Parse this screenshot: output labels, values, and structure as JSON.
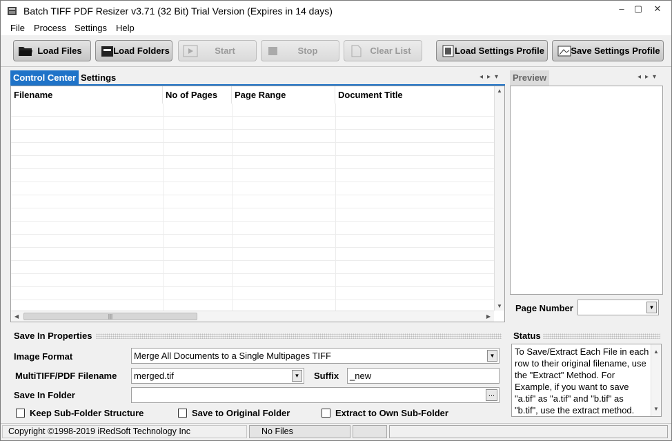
{
  "window": {
    "title": "Batch TIFF PDF Resizer v3.71 (32 Bit)  Trial Version (Expires in 14 days)",
    "controls": [
      "–",
      "▢",
      "✕"
    ]
  },
  "menu": [
    "File",
    "Process",
    "Settings",
    "Help"
  ],
  "toolbar": {
    "load_files": "Load Files",
    "load_folders": "Load Folders",
    "start": "Start",
    "stop": "Stop",
    "clear_list": "Clear List",
    "load_settings_profile": "Load Settings Profile",
    "save_settings_profile": "Save Settings Profile"
  },
  "tabs": {
    "control_center": "Control Center",
    "settings": "Settings",
    "preview": "Preview"
  },
  "grid": {
    "columns": [
      "Filename",
      "No of Pages",
      "Page Range",
      "Document Title"
    ],
    "rows": []
  },
  "preview": {
    "page_number_label": "Page Number",
    "page_number_value": ""
  },
  "save_in_properties": {
    "title": "Save In Properties",
    "image_format_label": "Image Format",
    "image_format_value": "Merge All Documents to a Single Multipages TIFF",
    "multitiff_label": "MultiTIFF/PDF Filename",
    "multitiff_value": "merged.tif",
    "suffix_label": "Suffix",
    "suffix_value": "_new",
    "save_in_folder_label": "Save In Folder",
    "save_in_folder_value": "",
    "browse": "...",
    "keep_subfolder": "Keep Sub-Folder Structure",
    "save_to_original": "Save to Original Folder",
    "extract_to_own": "Extract to Own Sub-Folder"
  },
  "status": {
    "title": "Status",
    "text": "To Save/Extract Each File in each row to their original filename, use the \"Extract\" Method. For Example, if you want to save \"a.tif\" as \"a.tif\" and \"b.tif\" as \"b.tif\", use the extract method."
  },
  "statusbar": {
    "copyright": "Copyright ©1998-2019 iRedSoft Technology Inc",
    "files": "No Files"
  },
  "colors": {
    "tab_active": "#1f73c8",
    "window_bg": "#f0f0f0"
  }
}
